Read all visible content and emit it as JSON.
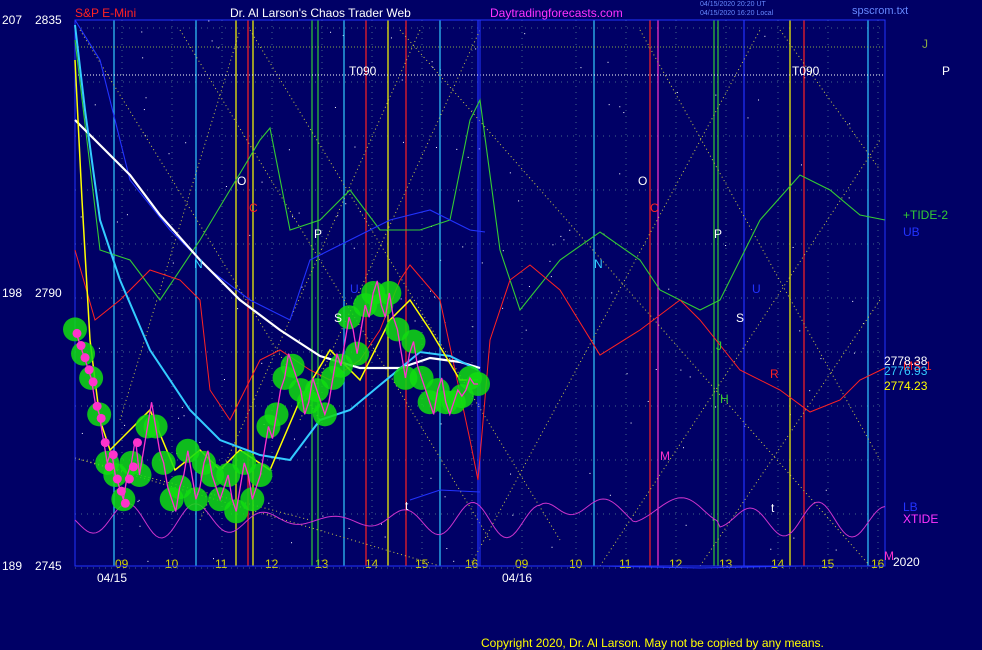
{
  "header": {
    "symbol": "S&P E-Mini",
    "site": "Dr. Al Larson's Chaos Trader Web",
    "url": "Daytradingforecasts.com",
    "file": "spscrom.txt",
    "timestamp_lines": [
      "04/15/2020 20:20 UT",
      "04/15/2020 16:20 Local"
    ]
  },
  "copyright": "Copyright 2020, Dr. Al Larson. May not be copied by any means.",
  "colors": {
    "background": "#000066",
    "price_axis": "#ffffff",
    "hour_labels": "#d4d400",
    "ma_white": "#ffffff",
    "ma_cyan": "#33ccff",
    "ma_yellow": "#ffff00",
    "price_magenta": "#ff33cc",
    "tide_green": "#33cc33",
    "red_line": "#ff2222",
    "blue_line": "#2233ff",
    "xtide_magenta": "#cc33cc",
    "glow_green": "#11dd11"
  },
  "chart_data": {
    "type": "line",
    "y_axis_left": [
      {
        "left": "207",
        "right": "2835",
        "price": 2835
      },
      {
        "left": "198",
        "right": "2790",
        "price": 2790
      },
      {
        "left": "189",
        "right": "2745",
        "price": 2745
      }
    ],
    "ylim": [
      2745,
      2835
    ],
    "hour_ticks": [
      "09",
      "10",
      "11",
      "12",
      "13",
      "14",
      "15",
      "16",
      "09",
      "10",
      "11",
      "12",
      "13",
      "14",
      "15",
      "16"
    ],
    "dates": [
      "04/15",
      "04/16"
    ],
    "time_lines": [
      {
        "label": "T090"
      },
      {
        "label": "T090"
      }
    ],
    "price_labels": [
      "2778.38",
      "2776.93",
      "2774.23"
    ],
    "right_labels": {
      "J": "J",
      "P": "P",
      "tide2": "+TIDE-2",
      "ub": "UB",
      "s1": "MS-1",
      "lb": "LB",
      "xtide": "XTIDE",
      "year": "2020",
      "m": "M"
    },
    "planet_markers": [
      "O",
      "C",
      "P",
      "N",
      "U",
      "S",
      "R",
      "H",
      "M",
      "J",
      "t"
    ],
    "series": [
      {
        "name": "price",
        "color": "#ff33cc",
        "x": [
          0,
          1,
          2,
          3,
          4,
          5,
          6,
          7,
          8,
          9,
          10,
          11,
          12,
          13,
          14,
          15,
          16,
          17,
          18,
          19,
          20,
          21,
          22,
          23,
          24,
          25,
          26,
          27,
          28,
          29,
          30,
          31,
          32,
          33,
          34,
          35,
          36,
          37,
          38,
          39,
          40,
          41,
          42,
          43,
          44,
          45,
          46,
          47,
          48,
          49,
          50,
          51,
          52,
          53,
          54,
          55,
          56,
          57,
          58,
          59,
          60,
          61,
          62,
          63,
          64,
          65,
          66,
          67,
          68,
          69,
          70,
          71,
          72,
          73,
          74,
          75,
          76,
          77,
          78,
          79,
          80,
          81,
          82,
          83,
          84,
          85,
          86,
          87,
          88,
          89,
          90,
          91,
          92,
          93,
          94,
          95,
          96,
          97,
          98,
          99,
          100
        ],
        "y": [
          2784,
          2782,
          2780,
          2778,
          2776,
          2772,
          2770,
          2766,
          2762,
          2764,
          2760,
          2758,
          2756,
          2760,
          2762,
          2766,
          2760,
          2764,
          2768,
          2772,
          2768,
          2764,
          2762,
          2758,
          2756,
          2754,
          2758,
          2760,
          2764,
          2760,
          2756,
          2758,
          2762,
          2764,
          2760,
          2758,
          2756,
          2758,
          2760,
          2756,
          2754,
          2758,
          2762,
          2760,
          2756,
          2758,
          2760,
          2764,
          2768,
          2766,
          2770,
          2774,
          2776,
          2780,
          2778,
          2776,
          2774,
          2770,
          2772,
          2776,
          2774,
          2772,
          2770,
          2772,
          2776,
          2780,
          2778,
          2782,
          2786,
          2784,
          2780,
          2784,
          2788,
          2786,
          2790,
          2792,
          2788,
          2786,
          2790,
          2786,
          2784,
          2780,
          2776,
          2780,
          2782,
          2778,
          2776,
          2774,
          2772,
          2770,
          2774,
          2776,
          2772,
          2770,
          2772,
          2774,
          2773,
          2774,
          2776,
          2775,
          2775
        ]
      }
    ]
  }
}
